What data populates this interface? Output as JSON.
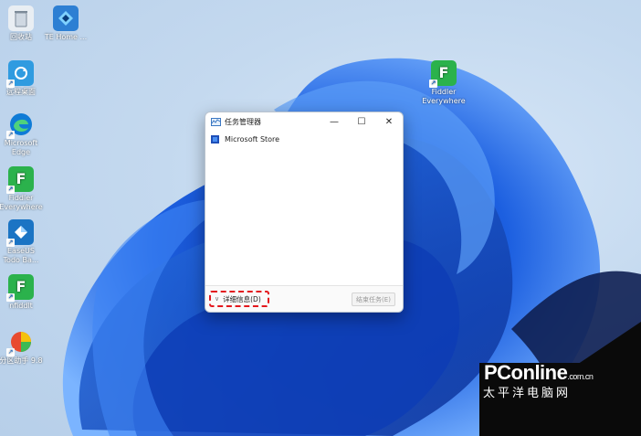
{
  "desktop": {
    "icons": [
      {
        "label": "回收站",
        "icon": "recycle-bin-icon",
        "color": "#e9eef3"
      },
      {
        "label": "TE Home ...",
        "icon": "te-home-icon",
        "color": "#2d7fd3"
      },
      {
        "label": "远程桌面",
        "icon": "sync-app-icon",
        "color": "#2f9be0"
      },
      {
        "label": "Microsoft\nEdge",
        "icon": "edge-icon",
        "color": "#0f7bd6"
      },
      {
        "label": "Fiddler\nEverywhere",
        "icon": "fiddler-icon",
        "color": "#2bb24c"
      },
      {
        "label": "EaseUS\nTodo Ba...",
        "icon": "easeus-icon",
        "color": "#1b74c4"
      },
      {
        "label": "nfiddlt",
        "icon": "fiddler-icon",
        "color": "#2bb24c"
      },
      {
        "label": "分区助手 9.8",
        "icon": "partition-assistant-icon",
        "color": "#e84a2e"
      },
      {
        "label": "Fiddler\nEverywhere",
        "icon": "fiddler-icon",
        "color": "#2bb24c"
      }
    ]
  },
  "task_manager": {
    "title": "任务管理器",
    "buttons": {
      "minimize": "—",
      "maximize": "☐",
      "close": "✕"
    },
    "apps": [
      {
        "name": "Microsoft Store"
      }
    ],
    "footer": {
      "details_label": "详细信息(D)",
      "end_task_label": "结束任务(E)"
    }
  },
  "watermark": {
    "brand": "PConline",
    "domain": ".com.cn",
    "cn": "太平洋电脑网"
  }
}
